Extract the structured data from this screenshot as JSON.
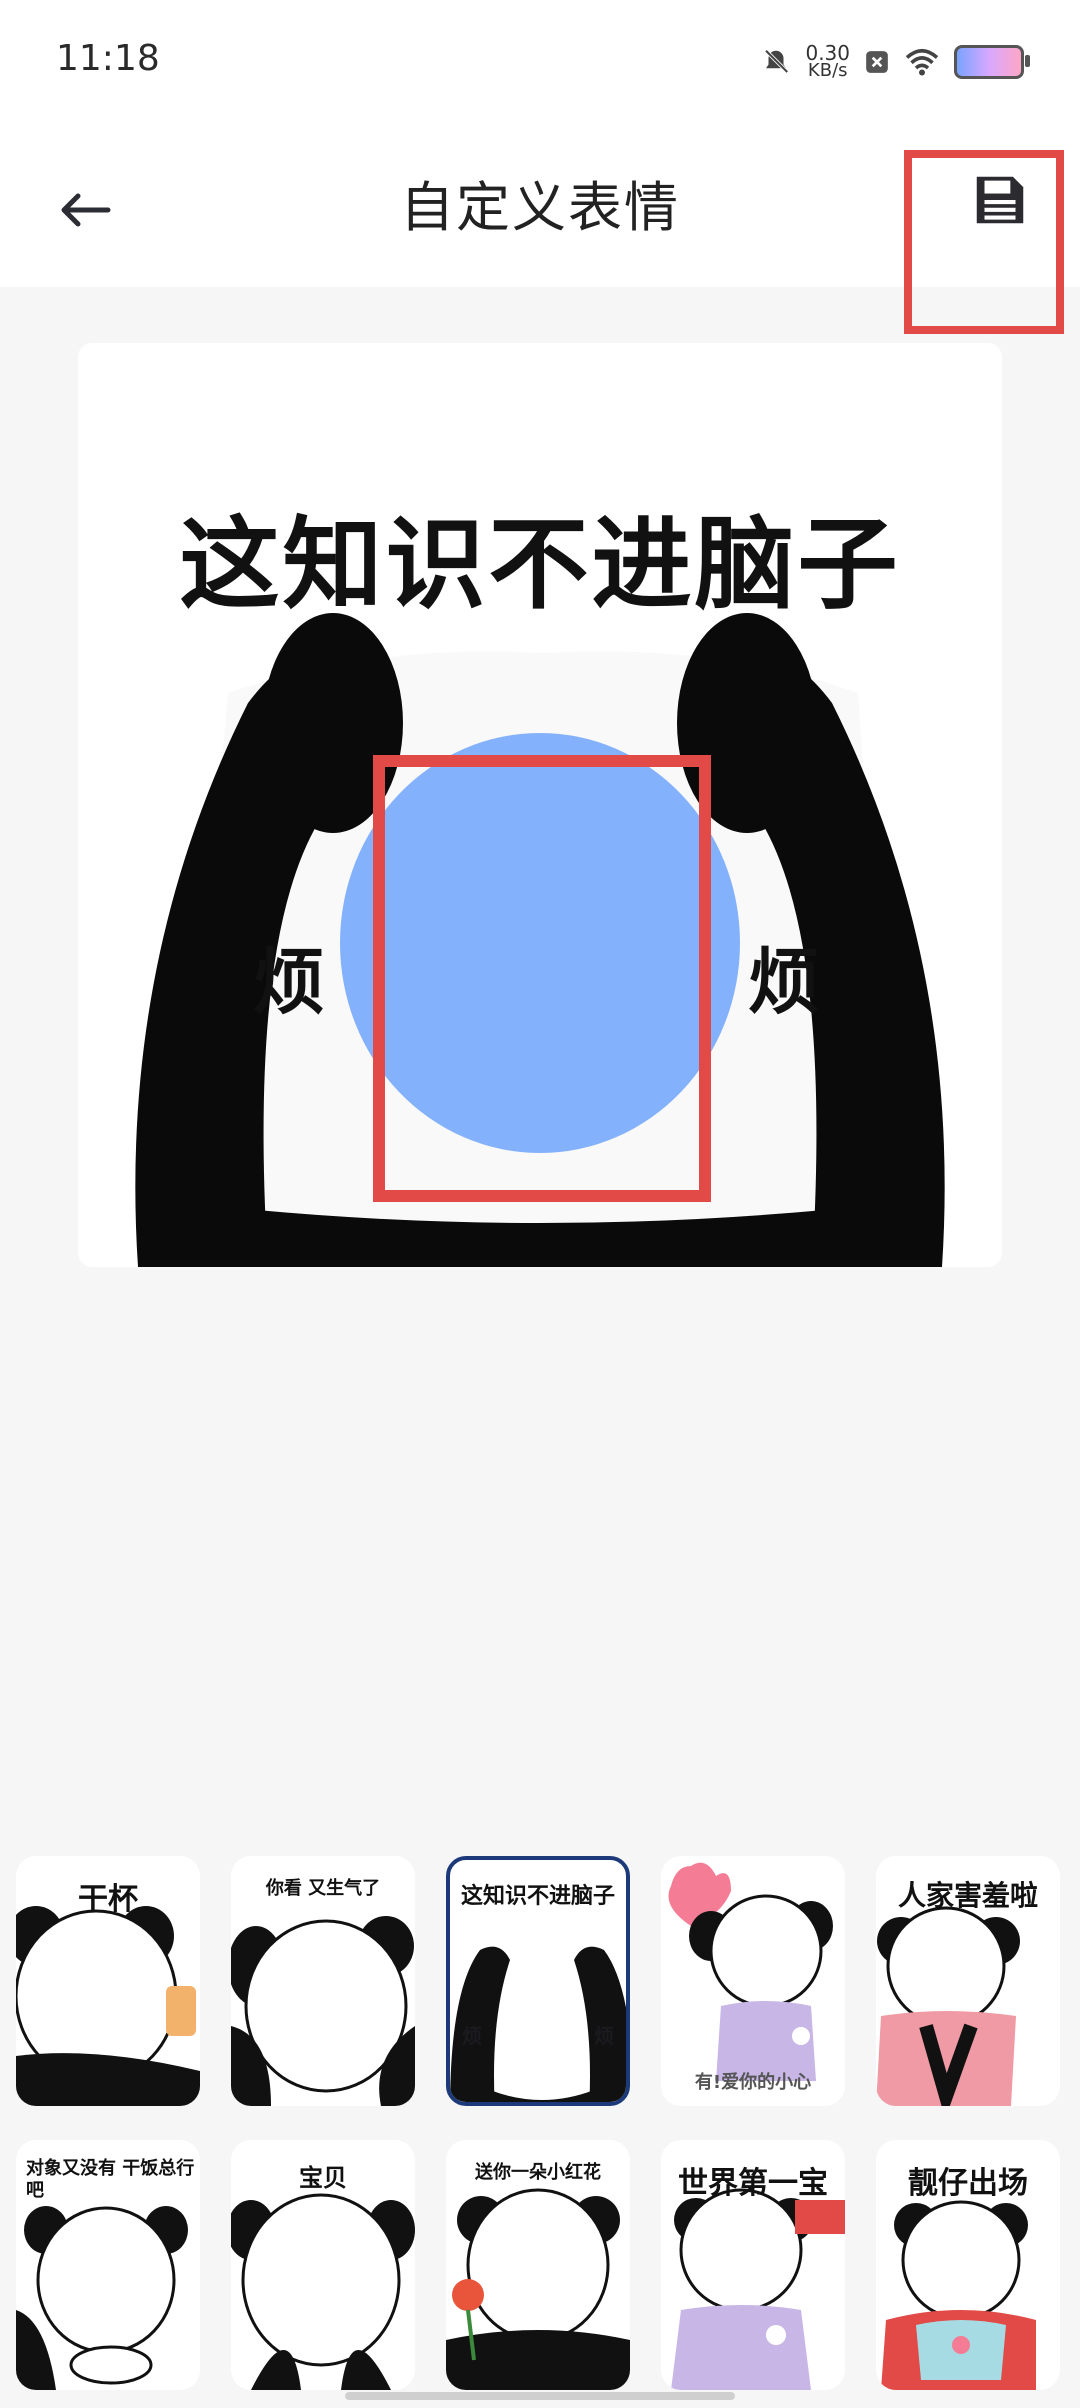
{
  "status_bar": {
    "time": "11:18",
    "net_speed_value": "0.30",
    "net_speed_unit": "KB/s",
    "icons": [
      "bell-mute-icon",
      "x-box-icon",
      "wifi-icon",
      "battery-icon"
    ]
  },
  "header": {
    "title": "自定义表情",
    "back_icon": "arrow-left-icon",
    "save_icon": "floppy-disk-icon"
  },
  "preview": {
    "caption": "这知识不进脑子",
    "left_text": "烦",
    "right_text": "烦",
    "face_color": "#84b1fb"
  },
  "stickers": [
    {
      "caption": "干杯",
      "selected": false
    },
    {
      "caption": "你看 又生气了",
      "selected": false
    },
    {
      "caption": "这知识不进脑子",
      "selected": true
    },
    {
      "caption": "有!爱你的小心",
      "selected": false
    },
    {
      "caption": "人家害羞啦",
      "selected": false
    },
    {
      "caption": "对象又没有 干饭总行吧",
      "selected": false
    },
    {
      "caption": "宝贝",
      "selected": false
    },
    {
      "caption": "送你一朵小红花",
      "selected": false
    },
    {
      "caption": "世界第一宝",
      "selected": false
    },
    {
      "caption": "靓仔出场",
      "selected": false
    }
  ],
  "colors": {
    "highlight": "#e14a46",
    "selected_border": "#1c3a7a"
  }
}
